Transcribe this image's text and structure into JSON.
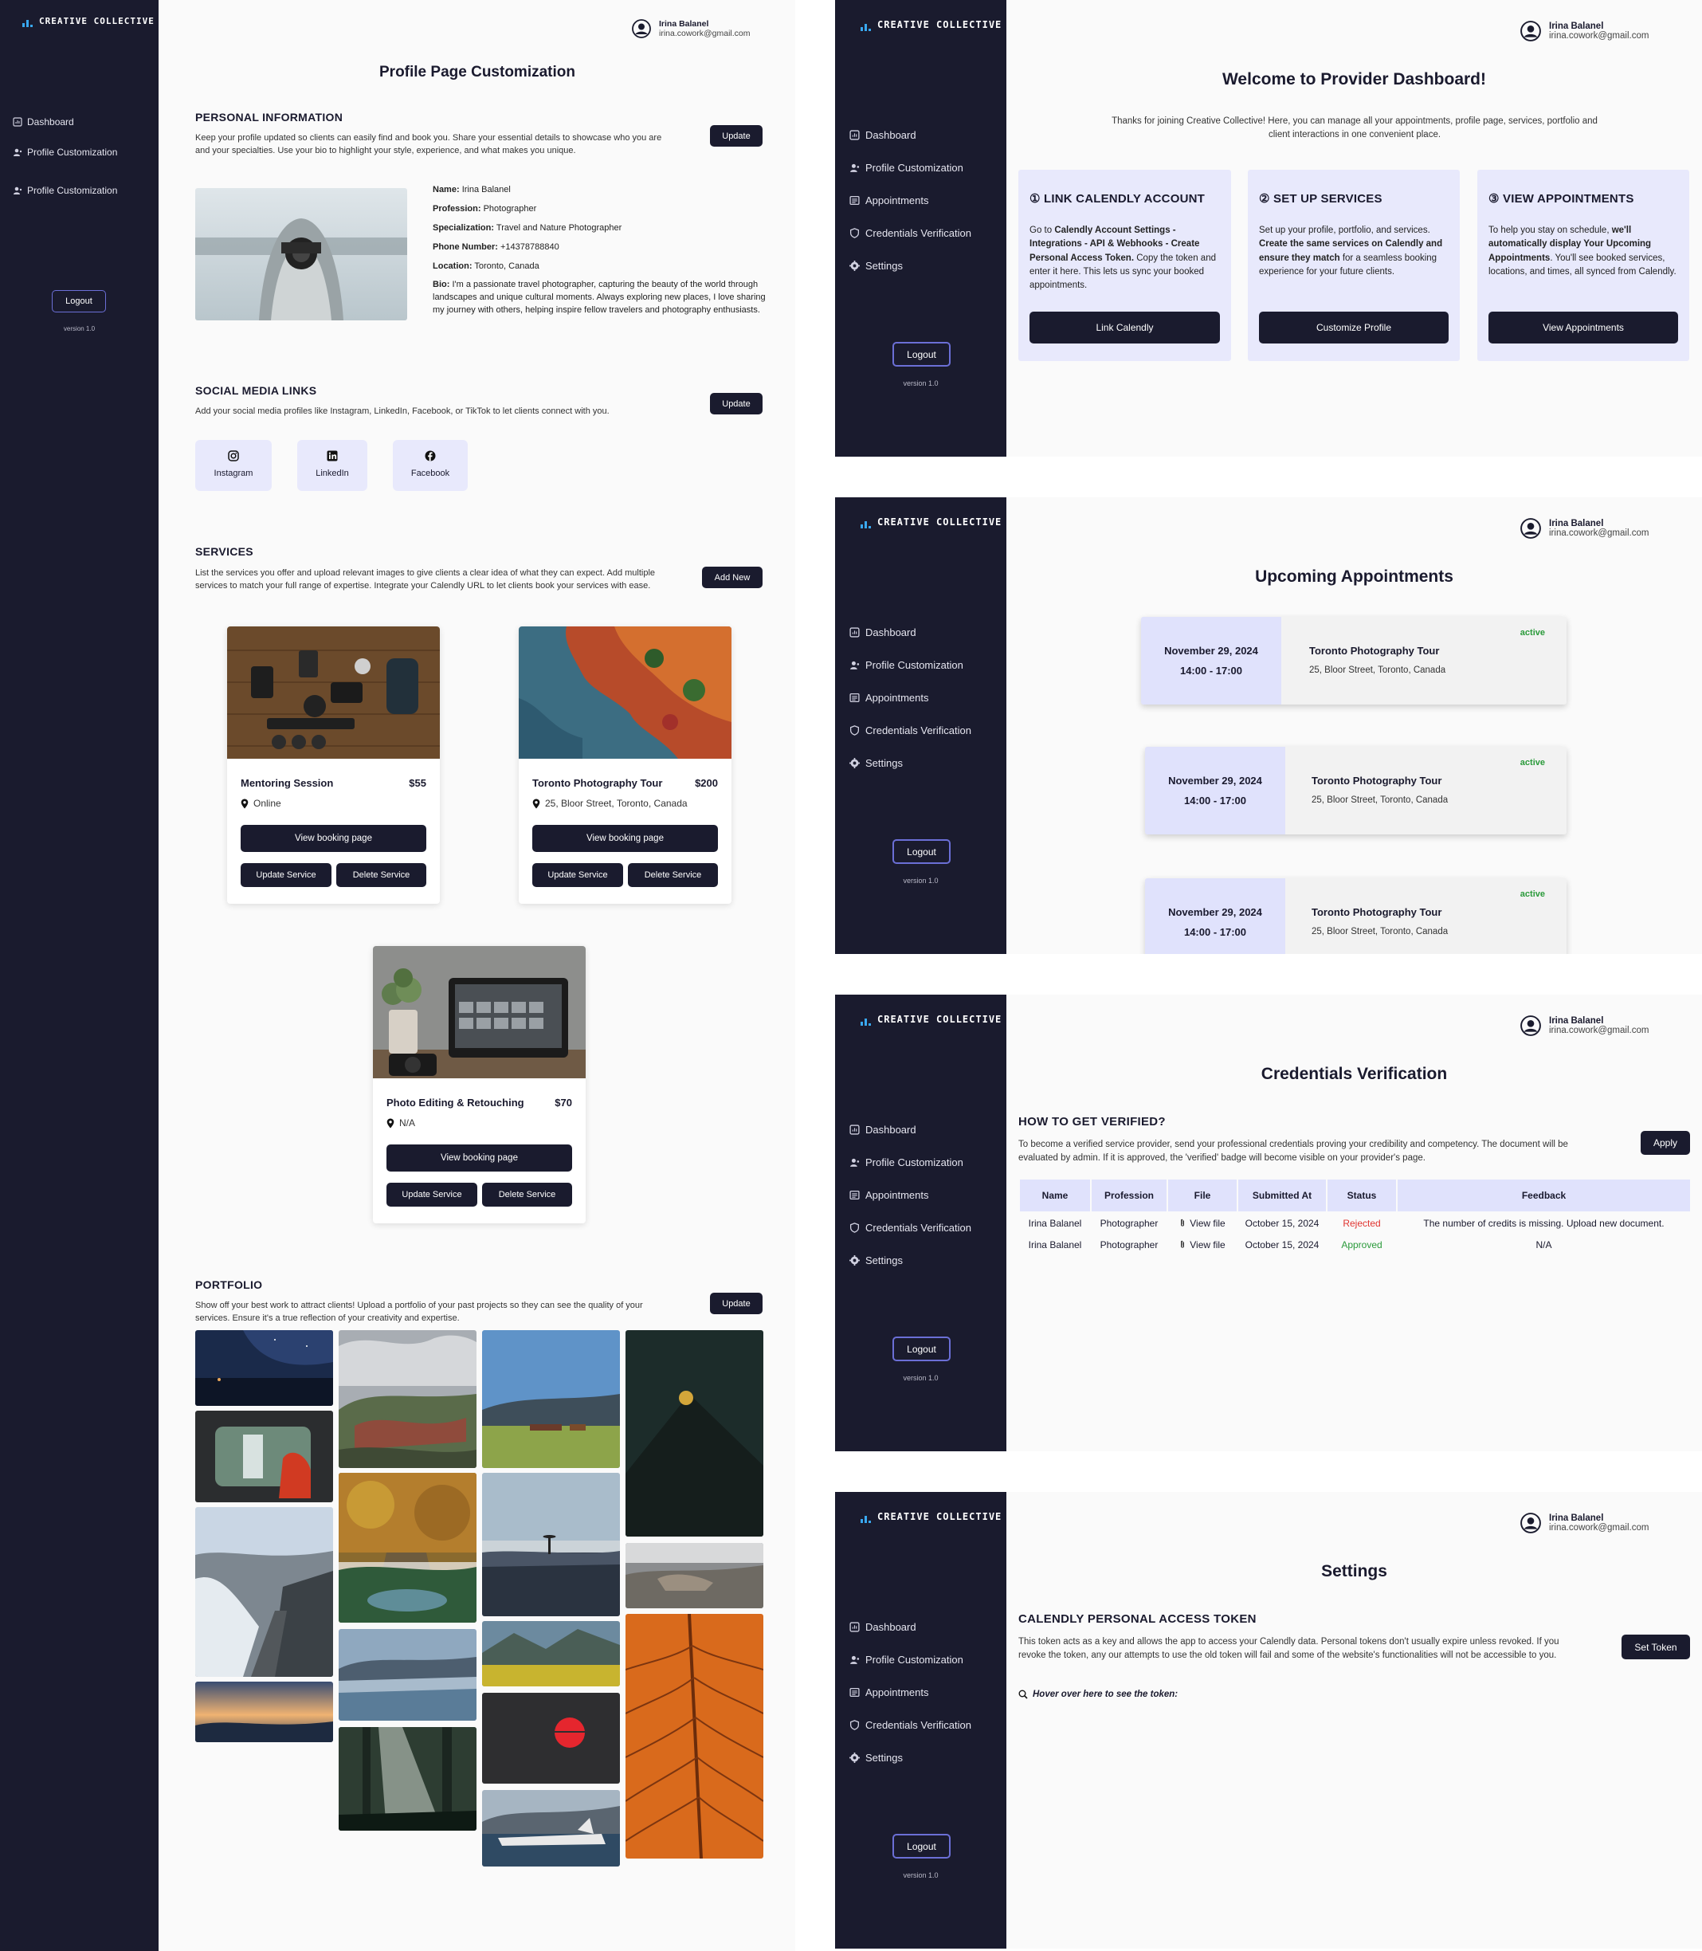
{
  "brand": "CREATIVE COLLECTIVE",
  "user": {
    "name": "Irina Balanel",
    "email": "irina.cowork@gmail.com"
  },
  "logout_label": "Logout",
  "version": "version 1.0",
  "nav_full": [
    "Dashboard",
    "Profile Customization",
    "Appointments",
    "Credentials Verification",
    "Settings"
  ],
  "profile_screen": {
    "nav": [
      "Dashboard",
      "Profile Customization",
      "Profile Customization"
    ],
    "title": "Profile Page Customization",
    "personal": {
      "heading": "PERSONAL INFORMATION",
      "description": "Keep your profile updated so clients can easily find and book you. Share your essential details to showcase who you are and your specialties. Use your bio to highlight your style, experience, and what makes you unique.",
      "update_label": "Update",
      "fields": [
        {
          "label": "Name:",
          "value": "Irina Balanel"
        },
        {
          "label": "Profession:",
          "value": "Photographer"
        },
        {
          "label": "Specialization:",
          "value": "Travel and Nature Photographer"
        },
        {
          "label": "Phone Number:",
          "value": "+14378788840"
        },
        {
          "label": "Location:",
          "value": "Toronto, Canada"
        },
        {
          "label": "Bio:",
          "value": "I'm a passionate travel photographer, capturing the beauty of the world through landscapes and unique cultural moments. Always exploring new places, I love sharing my journey with others, helping inspire fellow travelers and photography enthusiasts."
        }
      ]
    },
    "social": {
      "heading": "SOCIAL MEDIA LINKS",
      "description": "Add your social media profiles like Instagram, LinkedIn, Facebook, or TikTok to let clients connect with you.",
      "update_label": "Update",
      "links": [
        {
          "label": "Instagram",
          "icon": "instagram-icon"
        },
        {
          "label": "LinkedIn",
          "icon": "linkedin-icon"
        },
        {
          "label": "Facebook",
          "icon": "facebook-icon"
        }
      ]
    },
    "services": {
      "heading": "SERVICES",
      "description": "List the services you offer and upload relevant images to give clients a clear idea of what they can expect. Add multiple services to match your full range of expertise. Integrate your Calendly URL to let clients book your services with ease.",
      "add_label": "Add New",
      "view_label": "View booking page",
      "update_label": "Update Service",
      "delete_label": "Delete Service",
      "items": [
        {
          "name": "Mentoring Session",
          "price": "$55",
          "location": "Online"
        },
        {
          "name": "Toronto Photography Tour",
          "price": "$200",
          "location": "25, Bloor Street, Toronto, Canada"
        },
        {
          "name": "Photo Editing & Retouching",
          "price": "$70",
          "location": "N/A"
        }
      ]
    },
    "portfolio": {
      "heading": "PORTFOLIO",
      "description": "Show off your best work to attract clients! Upload a portfolio of your past projects so they can see the quality of your services. Ensure it's a true reflection of your creativity and expertise.",
      "update_label": "Update"
    }
  },
  "dashboard": {
    "title": "Welcome to Provider Dashboard!",
    "intro": "Thanks for joining Creative Collective! Here, you can manage all your appointments, profile page, services, portfolio and client interactions in one convenient place.",
    "steps": [
      {
        "title": "① LINK CALENDLY ACCOUNT",
        "button": "Link Calendly"
      },
      {
        "title": "② SET UP SERVICES",
        "button": "Customize Profile"
      },
      {
        "title": "③ VIEW APPOINTMENTS",
        "button": "View Appointments"
      }
    ],
    "step_texts": {
      "s1_a": "Go to ",
      "s1_b": "Calendly Account Settings - Integrations - API & Webhooks - Create Personal Access Token.",
      "s1_c": " Copy the token and enter it here. This lets us sync your booked appointments.",
      "s2_a": "Set up your profile, portfolio, and services. ",
      "s2_b": "Create the same services on Calendly and ensure they match",
      "s2_c": " for a seamless booking experience for your future clients.",
      "s3_a": "To help you stay on schedule, ",
      "s3_b": "we'll automatically display Your Upcoming Appointments",
      "s3_c": ". You'll see booked services, locations, and times, all synced from Calendly."
    }
  },
  "appointments": {
    "title": "Upcoming Appointments",
    "items": [
      {
        "date": "November 29, 2024",
        "time": "14:00 - 17:00",
        "title": "Toronto Photography Tour",
        "address": "25, Bloor Street, Toronto, Canada",
        "status": "active"
      },
      {
        "date": "November 29, 2024",
        "time": "14:00 - 17:00",
        "title": "Toronto Photography Tour",
        "address": "25, Bloor Street, Toronto, Canada",
        "status": "active"
      },
      {
        "date": "November 29, 2024",
        "time": "14:00 - 17:00",
        "title": "Toronto Photography Tour",
        "address": "25, Bloor Street, Toronto, Canada",
        "status": "active"
      }
    ]
  },
  "credentials": {
    "title": "Credentials Verification",
    "heading": "HOW TO GET VERIFIED?",
    "description": "To become a verified service provider, send your professional credentials proving your credibility and competency. The document will be evaluated by admin. If it is approved, the 'verified' badge will become visible on your provider's page.",
    "apply_label": "Apply",
    "columns": [
      "Name",
      "Profession",
      "File",
      "Submitted At",
      "Status",
      "Feedback"
    ],
    "rows": [
      {
        "name": "Irina Balanel",
        "profession": "Photographer",
        "file": "View file",
        "submitted": "October 15, 2024",
        "status": "Rejected",
        "feedback": "The number of credits is missing. Upload new document."
      },
      {
        "name": "Irina Balanel",
        "profession": "Photographer",
        "file": "View file",
        "submitted": "October 15, 2024",
        "status": "Approved",
        "feedback": "N/A"
      }
    ],
    "status_colors": {
      "Rejected": "#e0332f",
      "Approved": "#2a9a3a"
    }
  },
  "settings": {
    "title": "Settings",
    "heading": "CALENDLY PERSONAL ACCESS TOKEN",
    "description": "This token acts as a key and allows the app to access your Calendly data. Personal tokens don't usually expire unless revoked. If you revoke the token, any our attempts to use the old token will fail and some of the website's functionalities will not be accessible to you.",
    "button": "Set Token",
    "hover_hint": "Hover over here to see the token:"
  },
  "colors": {
    "sidebar": "#1a1b2e",
    "accent_card": "#e8e9fc",
    "status_active": "#2a9a3a"
  }
}
